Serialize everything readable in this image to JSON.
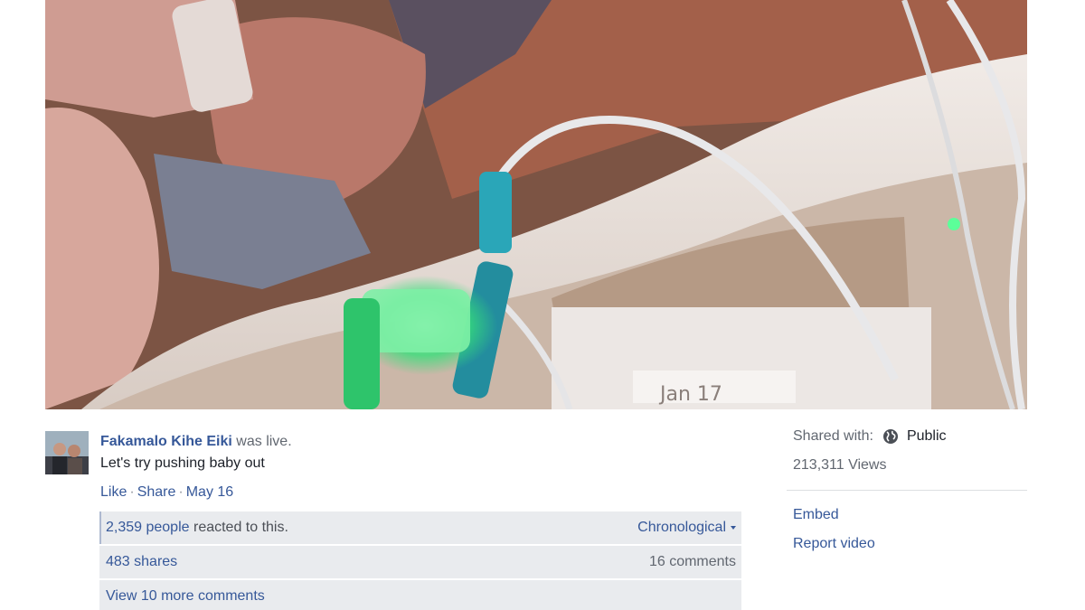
{
  "video": {
    "date_stamp": "Jan 17"
  },
  "post": {
    "author": "Fakamalo Kihe Eiki",
    "status": "was live.",
    "message": "Let's try pushing baby out",
    "actions": {
      "like": "Like",
      "share": "Share",
      "date": "May 16",
      "separator": "·"
    }
  },
  "ufi": {
    "reactions_count": "2,359 people",
    "reactions_suffix": "reacted to this.",
    "sort_label": "Chronological",
    "shares": "483 shares",
    "comments": "16 comments",
    "view_more": "View 10 more comments"
  },
  "sidebar": {
    "shared_with_label": "Shared with:",
    "privacy": "Public",
    "views": "213,311 Views",
    "links": [
      "Embed",
      "Report video"
    ]
  },
  "colors": {
    "link": "#365899",
    "ufi_bg": "#e9ebee",
    "iv_connector": "#2aa6b8",
    "wristband_light": "#36e07a"
  },
  "icons": {
    "privacy": "globe-icon",
    "sort": "caret-down-icon"
  }
}
